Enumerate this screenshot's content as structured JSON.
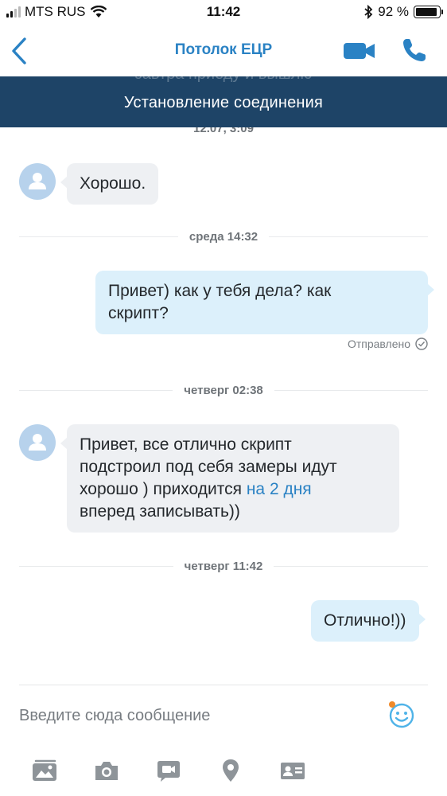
{
  "status_bar": {
    "carrier": "MTS RUS",
    "time": "11:42",
    "battery_percent": "92 %",
    "battery_level": 0.92,
    "signal_bars_filled": 2,
    "signal_bars_total": 4
  },
  "nav": {
    "title": "Потолок ЕЦР",
    "back_icon": "chevron-left-icon",
    "video_icon": "video-camera-icon",
    "call_icon": "phone-icon"
  },
  "banner": {
    "ghost_text": "завтра приеду и вышлю",
    "text": "Установление соединения"
  },
  "chat": {
    "partial_timestamp": "12.07, 3:09",
    "messages": [
      {
        "direction": "in",
        "text": "Хорошо."
      },
      {
        "type": "separator",
        "label": "среда 14:32"
      },
      {
        "direction": "out",
        "text_line1": "Привет) как у тебя дела? как",
        "text_line2": "скрипт?",
        "status": "Отправлено"
      },
      {
        "type": "separator",
        "label": "четверг 02:38"
      },
      {
        "direction": "in",
        "line1": "Привет, все отлично скрипт",
        "line2": "подстроил под себя замеры идут",
        "line3_prefix": "хорошо ) приходится ",
        "line3_link": "на 2 дня",
        "line4": "вперед записывать))"
      },
      {
        "type": "separator",
        "label": "четверг 11:42"
      },
      {
        "direction": "out",
        "text": "Отлично!))"
      }
    ]
  },
  "composer": {
    "placeholder": "Введите сюда сообщение",
    "emoji_icon": "smiley-icon"
  },
  "toolbar": {
    "items": [
      "gallery-icon",
      "camera-icon",
      "video-message-icon",
      "location-pin-icon",
      "contact-card-icon"
    ]
  },
  "colors": {
    "accent": "#2a82c4",
    "banner_bg": "#1e4467",
    "incoming_bubble": "#eef0f3",
    "outgoing_bubble": "#dcf0fb",
    "avatar_bg": "#b7d2ec"
  }
}
